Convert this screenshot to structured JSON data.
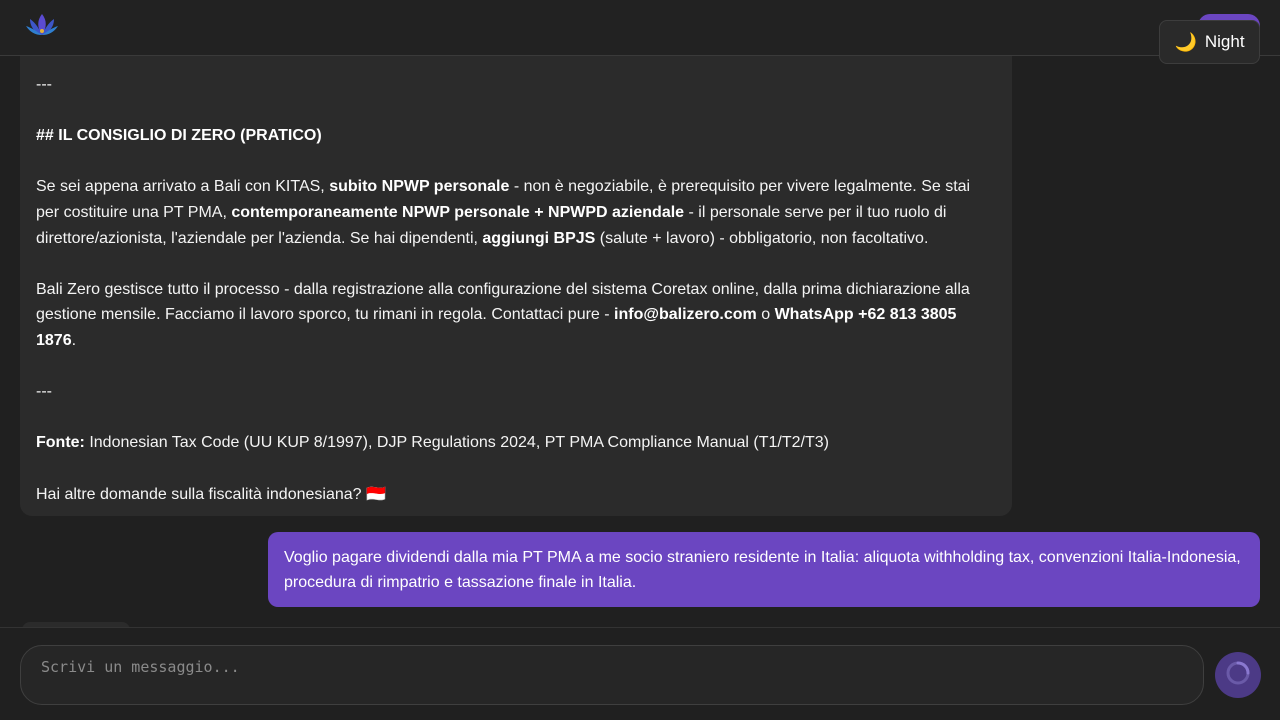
{
  "header": {
    "logo_icon": "lotus-icon",
    "night_toggle": {
      "icon": "moon-icon",
      "label": "Night"
    }
  },
  "assistant_message": {
    "separator": "---",
    "heading": "## IL CONSIGLIO DI ZERO (PRATICO)",
    "para1": {
      "t1": "Se sei appena arrivato a Bali con KITAS, ",
      "b1": "subito NPWP personale",
      "t2": " - non è negoziabile, è prerequisito per vivere legalmente. Se stai per costituire una PT PMA, ",
      "b2": "contemporaneamente NPWP personale + NPWPD aziendale",
      "t3": " - il personale serve per il tuo ruolo di direttore/azionista, l'aziendale per l'azienda. Se hai dipendenti, ",
      "b3": "aggiungi BPJS",
      "t4": " (salute + lavoro) - obbligatorio, non facoltativo."
    },
    "para2": {
      "t1": "Bali Zero gestisce tutto il processo - dalla registrazione alla configurazione del sistema Coretax online, dalla prima dichiarazione alla gestione mensile. Facciamo il lavoro sporco, tu rimani in regola. Contattaci pure - ",
      "b1": "info@balizero.com",
      "t2": " o ",
      "b2": "WhatsApp +62 813 3805 1876",
      "t3": "."
    },
    "source": {
      "label": "Fonte:",
      "text": " Indonesian Tax Code (UU KUP 8/1997), DJP Regulations 2024, PT PMA Compliance Manual (T1/T2/T3)"
    },
    "closing": "Hai altre domande sulla fiscalità indonesiana? 🇮🇩"
  },
  "user_message": {
    "text": "Voglio pagare dividendi dalla mia PT PMA a me socio straniero residente in Italia: aliquota withholding tax, convenzioni Italia-Indonesia, procedura di rimpatrio e tassazione finale in Italia."
  },
  "composer": {
    "placeholder": "Scrivi un messaggio...",
    "send_icon": "spinner-icon"
  },
  "colors": {
    "accent": "#6b46c1",
    "background": "#202020",
    "bubble": "#2b2b2b"
  }
}
